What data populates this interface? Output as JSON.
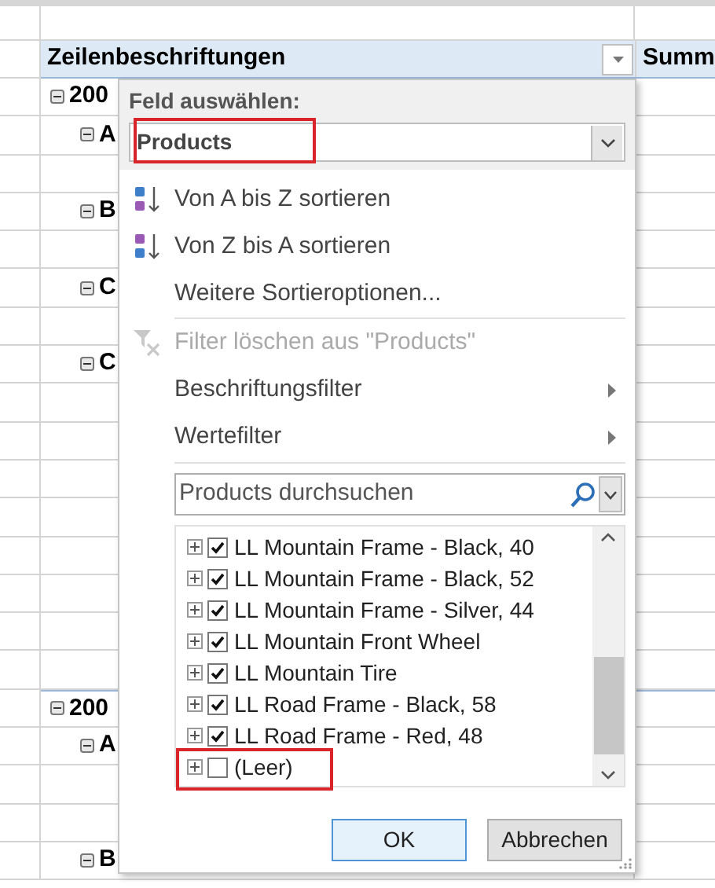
{
  "pivot": {
    "header": "Zeilenbeschriftungen",
    "next_column_header": "Summ",
    "rows": [
      {
        "label": "200",
        "expanded": true,
        "children": [
          {
            "label": "A",
            "expanded": true
          },
          {
            "label": "B",
            "expanded": true
          },
          {
            "label": "C",
            "expanded": true
          },
          {
            "label": "C",
            "expanded": true
          }
        ]
      },
      {
        "label": "200",
        "expanded": true,
        "children": [
          {
            "label": "A",
            "expanded": true
          },
          {
            "label": "B",
            "expanded": true
          }
        ]
      }
    ]
  },
  "popup": {
    "title": "Feld auswählen:",
    "field": {
      "value": "Products",
      "highlighted": true
    },
    "menu": [
      {
        "kind": "sort_asc",
        "label": "Von A bis Z sortieren",
        "disabled": false
      },
      {
        "kind": "sort_desc",
        "label": "Von Z bis A sortieren",
        "disabled": false
      },
      {
        "kind": "plain",
        "label": "Weitere Sortieroptionen...",
        "disabled": false
      },
      {
        "kind": "clear_filter",
        "label": "Filter löschen aus \"Products\"",
        "disabled": true
      },
      {
        "kind": "submenu",
        "label": "Beschriftungsfilter",
        "disabled": false
      },
      {
        "kind": "submenu",
        "label": "Wertefilter",
        "disabled": false
      }
    ],
    "search": {
      "placeholder": "Products durchsuchen"
    },
    "items": [
      {
        "label": "LL Mountain Frame - Black, 40",
        "checked": true,
        "highlighted": false
      },
      {
        "label": "LL Mountain Frame - Black, 52",
        "checked": true,
        "highlighted": false
      },
      {
        "label": "LL Mountain Frame - Silver, 44",
        "checked": true,
        "highlighted": false
      },
      {
        "label": "LL Mountain Front Wheel",
        "checked": true,
        "highlighted": false
      },
      {
        "label": "LL Mountain Tire",
        "checked": true,
        "highlighted": false
      },
      {
        "label": "LL Road Frame - Black, 58",
        "checked": true,
        "highlighted": false
      },
      {
        "label": "LL Road Frame - Red, 48",
        "checked": true,
        "highlighted": false
      },
      {
        "label": "(Leer)",
        "checked": false,
        "highlighted": true
      }
    ],
    "buttons": [
      {
        "label": "OK",
        "default": true
      },
      {
        "label": "Abbrechen",
        "default": false
      }
    ]
  }
}
